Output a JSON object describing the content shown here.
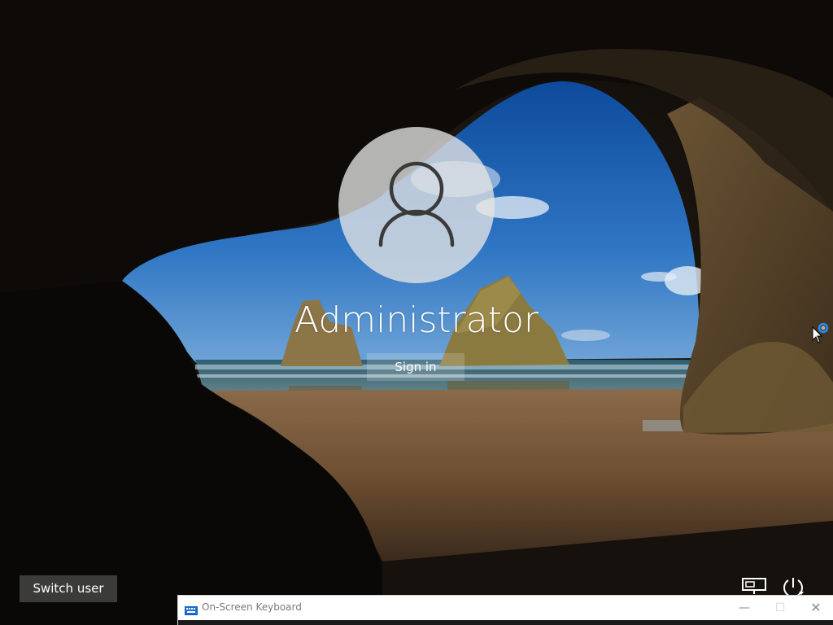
{
  "lock_screen": {
    "username": "Administrator",
    "sign_in_label": "Sign in",
    "switch_user_label": "Switch user"
  },
  "icons": {
    "avatar": "user-silhouette-icon",
    "network": "network-icon",
    "power": "power-icon",
    "loading": "busy-ring-icon",
    "cursor": "mouse-pointer"
  },
  "osk": {
    "title": "On-Screen Keyboard",
    "minimize_glyph": "—",
    "maximize_glyph": "☐",
    "close_glyph": "✕"
  },
  "colors": {
    "accent_ring": "#1e90ff",
    "button_bg": "#5a5a5a"
  }
}
